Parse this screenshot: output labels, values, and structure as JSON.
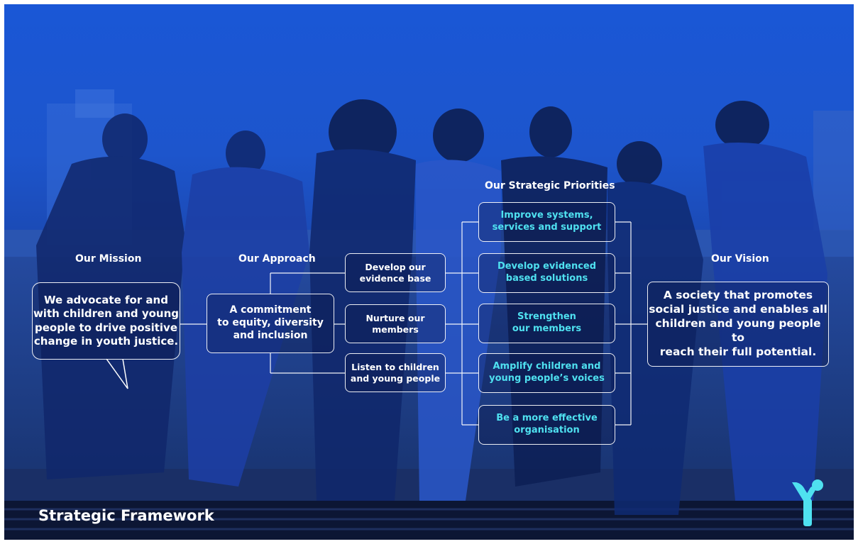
{
  "headings": {
    "mission": "Our Mission",
    "approach": "Our Approach",
    "priorities": "Our Strategic Priorities",
    "vision": "Our Vision"
  },
  "mission": {
    "line1": "We advocate for and",
    "line2": "with children and young",
    "line3": "people to drive positive",
    "line4": "change in youth justice."
  },
  "approach": {
    "line1": "A commitment",
    "line2": "to equity, diversity",
    "line3": "and inclusion"
  },
  "approach_items": [
    {
      "line1": "Develop our",
      "line2": "evidence base"
    },
    {
      "line1": "Nurture our",
      "line2": "members"
    },
    {
      "line1": "Listen to children",
      "line2": "and young people"
    }
  ],
  "priorities": [
    {
      "line1": "Improve systems,",
      "line2": "services and support"
    },
    {
      "line1": "Develop evidenced",
      "line2": "based solutions"
    },
    {
      "line1": "Strengthen",
      "line2": "our members"
    },
    {
      "line1": "Amplify children and",
      "line2": "young people’s voices"
    },
    {
      "line1": "Be a more effective",
      "line2": "organisation"
    }
  ],
  "vision": {
    "line1": "A society that promotes",
    "line2": "social justice and enables all",
    "line3": "children and young people to",
    "line4": "reach their full potential."
  },
  "footer_title": "Strategic Framework",
  "colors": {
    "background_blue": "#1a57d6",
    "priority_text": "#4fe1f0",
    "line_color": "#ffffff",
    "logo_cyan": "#4fe1f0"
  },
  "icons": {
    "logo": "youth-justice-y-logo"
  }
}
